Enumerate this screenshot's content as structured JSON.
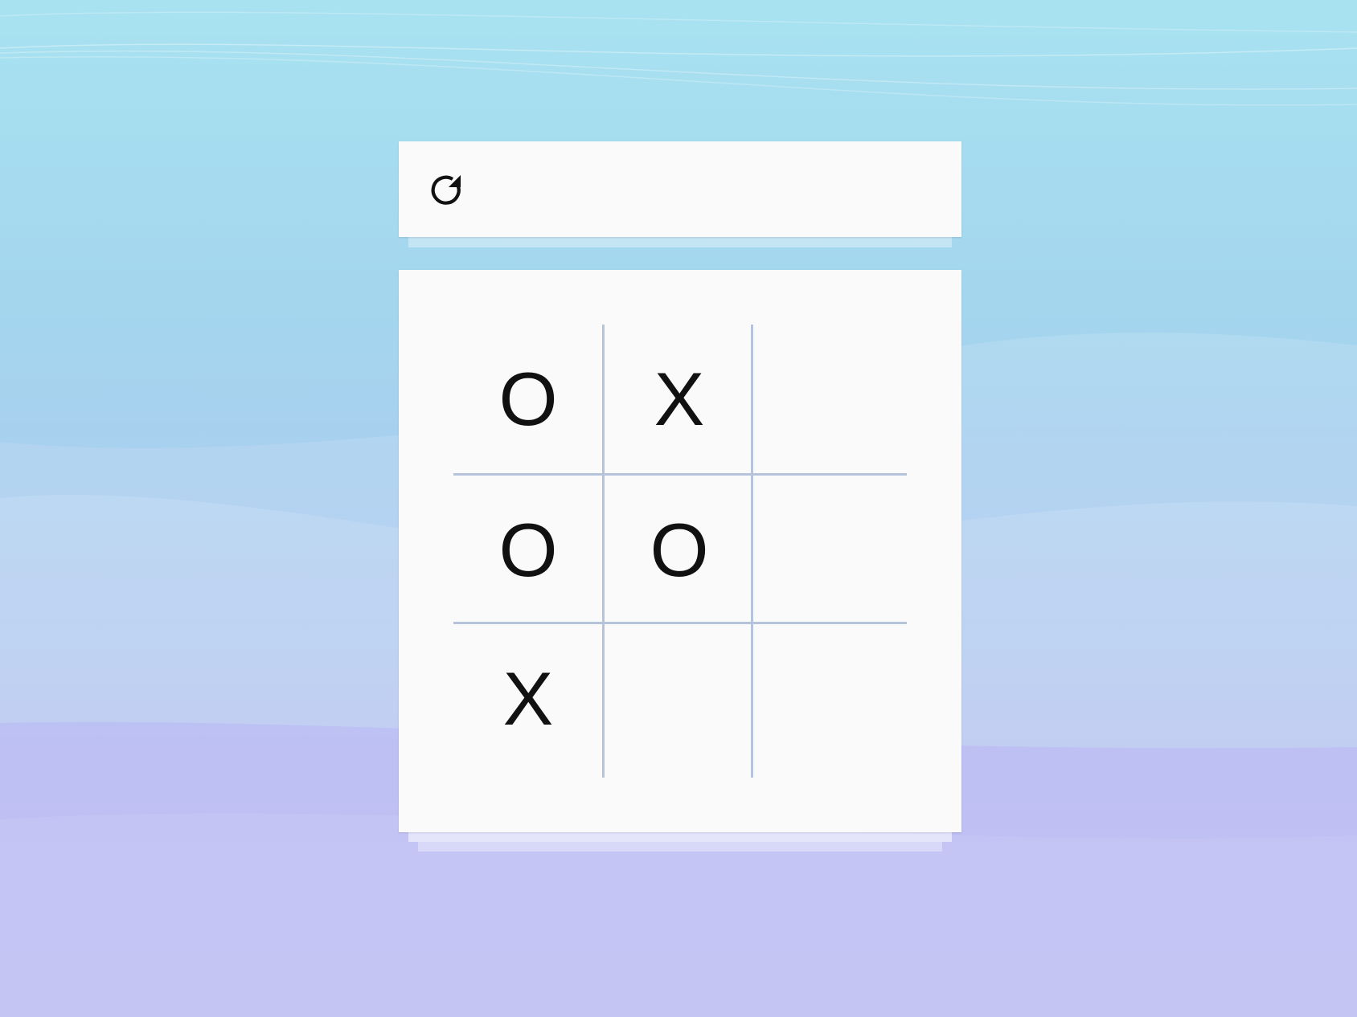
{
  "colors": {
    "card_background": "#fafafa",
    "grid_line": "#b5c4da",
    "mark": "#111111",
    "background_top": "#a8e2f0",
    "background_bottom": "#b8c0ee"
  },
  "toolbar": {
    "reset_icon": "reset-icon"
  },
  "board": {
    "rows": [
      [
        "O",
        "X",
        ""
      ],
      [
        "O",
        "O",
        ""
      ],
      [
        "X",
        "",
        ""
      ]
    ]
  }
}
